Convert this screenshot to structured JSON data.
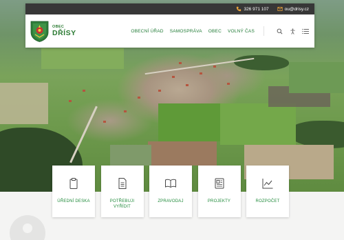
{
  "topbar": {
    "phone": "326 971 107",
    "email": "ou@drisy.cz"
  },
  "logo": {
    "small": "OBEC",
    "big": "DŘÍSY"
  },
  "menu": [
    {
      "label": "OBECNÍ ÚŘAD"
    },
    {
      "label": "SAMOSPRÁVA"
    },
    {
      "label": "OBEC"
    },
    {
      "label": "VOLNÝ ČAS"
    }
  ],
  "tools": [
    "search-icon",
    "accessibility-icon",
    "hamburger-menu-icon"
  ],
  "tiles": [
    {
      "label": "ÚŘEDNÍ DESKA",
      "icon": "clipboard-icon"
    },
    {
      "label": "POTŘEBUJI VYŘÍDIT",
      "icon": "document-icon"
    },
    {
      "label": "ZPRAVODAJ",
      "icon": "open-book-icon"
    },
    {
      "label": "PROJEKTY",
      "icon": "newspaper-icon"
    },
    {
      "label": "ROZPOČET",
      "icon": "line-chart-icon"
    }
  ],
  "colors": {
    "brand_green": "#1f8a3a",
    "topbar_bg": "#373737",
    "icon_orange": "#e8a23a"
  }
}
